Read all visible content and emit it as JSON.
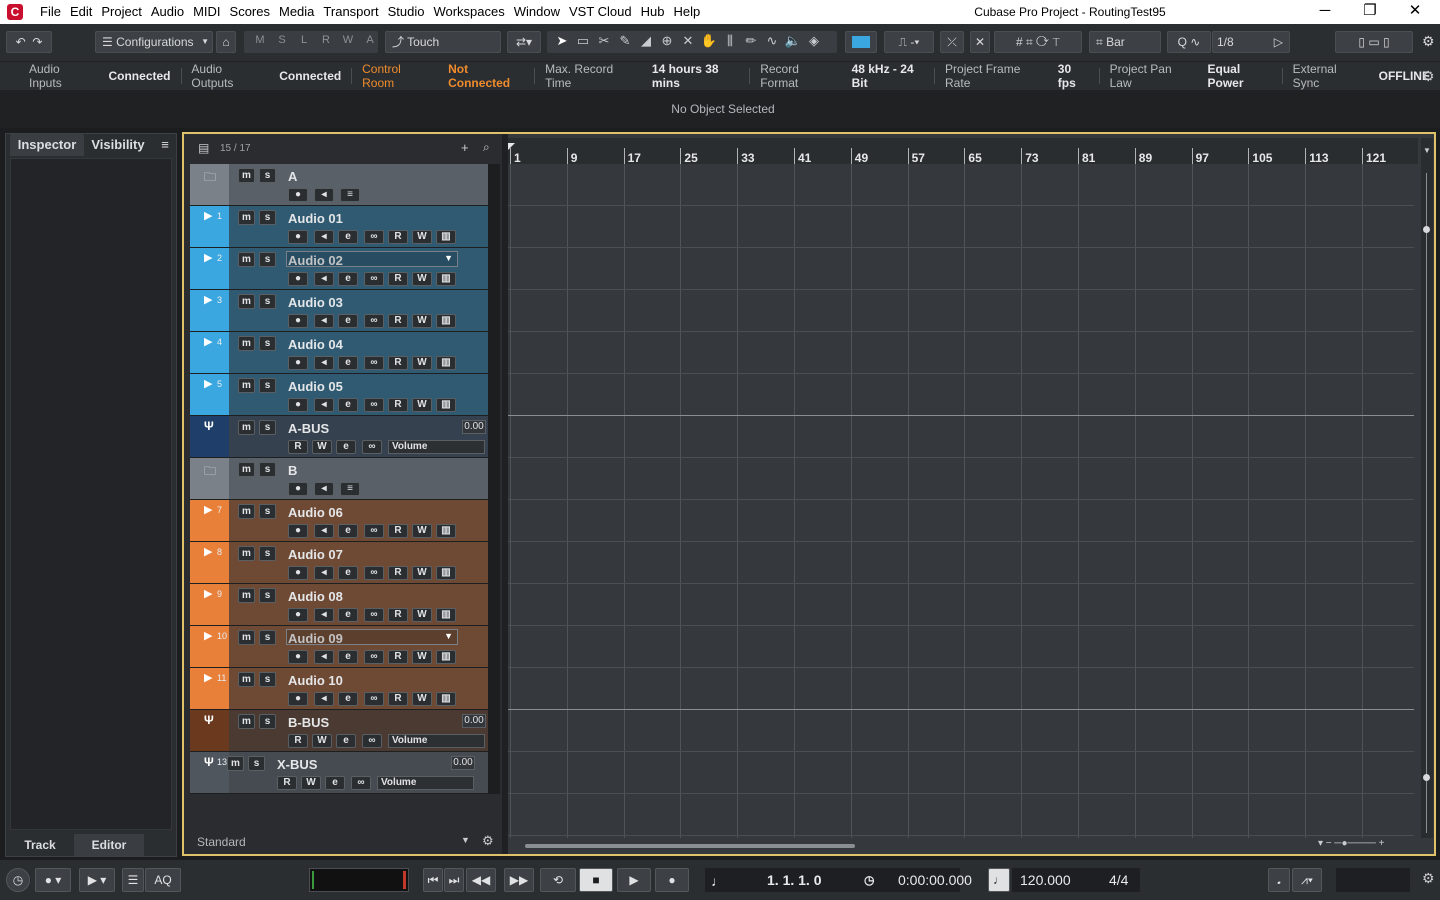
{
  "menubar": {
    "items": [
      "File",
      "Edit",
      "Project",
      "Audio",
      "MIDI",
      "Scores",
      "Media",
      "Transport",
      "Studio",
      "Workspaces",
      "Window",
      "VST Cloud",
      "Hub",
      "Help"
    ],
    "window_title": "Cubase Pro Project - RoutingTest95",
    "minimize": "─",
    "maximize": "❐",
    "close": "✕"
  },
  "toolbar": {
    "configurations": "Configurations",
    "states": [
      "M",
      "S",
      "L",
      "R",
      "W",
      "A"
    ],
    "automation_mode": "Touch",
    "grid_type": "Bar",
    "quantize": "1/8"
  },
  "status": {
    "audio_inputs_label": "Audio Inputs",
    "audio_inputs_value": "Connected",
    "audio_outputs_label": "Audio Outputs",
    "audio_outputs_value": "Connected",
    "control_room_label": "Control Room",
    "control_room_value": "Not Connected",
    "max_record_label": "Max. Record Time",
    "max_record_value": "14 hours 38 mins",
    "record_format_label": "Record Format",
    "record_format_value": "48 kHz - 24 Bit",
    "frame_rate_label": "Project Frame Rate",
    "frame_rate_value": "30 fps",
    "pan_law_label": "Project Pan Law",
    "pan_law_value": "Equal Power",
    "ext_sync_label": "External Sync",
    "ext_sync_value": "OFFLINE",
    "info_line": "No Object Selected"
  },
  "inspector": {
    "tab_inspector": "Inspector",
    "tab_visibility": "Visibility",
    "tab_track": "Track",
    "tab_editor": "Editor"
  },
  "tracklist": {
    "count": "15 / 17",
    "footer": "Standard",
    "tracks": [
      {
        "type": "folder",
        "name": "A",
        "num": ""
      },
      {
        "type": "audio",
        "name": "Audio 01",
        "num": "1"
      },
      {
        "type": "audio",
        "name": "Audio 02",
        "num": "2"
      },
      {
        "type": "audio",
        "name": "Audio 03",
        "num": "3"
      },
      {
        "type": "audio",
        "name": "Audio 04",
        "num": "4"
      },
      {
        "type": "audio",
        "name": "Audio 05",
        "num": "5"
      },
      {
        "type": "group",
        "name": "A-BUS",
        "num": "",
        "vol": "0.00",
        "vol_label": "Volume"
      },
      {
        "type": "folder",
        "name": "B",
        "num": ""
      },
      {
        "type": "audio",
        "name": "Audio 06",
        "num": "7"
      },
      {
        "type": "audio",
        "name": "Audio 07",
        "num": "8"
      },
      {
        "type": "audio",
        "name": "Audio 08",
        "num": "9"
      },
      {
        "type": "audio",
        "name": "Audio 09",
        "num": "10"
      },
      {
        "type": "audio",
        "name": "Audio 10",
        "num": "11"
      },
      {
        "type": "group",
        "name": "B-BUS",
        "num": "",
        "vol": "0.00",
        "vol_label": "Volume"
      },
      {
        "type": "group",
        "name": "X-BUS",
        "num": "13",
        "vol": "0.00",
        "vol_label": "Volume"
      }
    ],
    "colors": {
      "blue": "#3ba7e0",
      "blue_bg": "#2f5a72",
      "orange": "#e8803a",
      "orange_bg": "#6e4a35",
      "folder_bg": "#5a6068",
      "bus_blue": "#1f3f6a",
      "bus_orange": "#6b3a1e",
      "bus_x": "#4a5058"
    }
  },
  "ruler": {
    "bars": [
      "1",
      "9",
      "17",
      "25",
      "33",
      "41",
      "49",
      "57",
      "65",
      "73",
      "81",
      "89",
      "97",
      "105",
      "113",
      "121"
    ]
  },
  "transport": {
    "position": "1.  1.  1.    0",
    "time": "0:00:00.000",
    "tempo": "120.000",
    "signature": "4/4",
    "aq": "AQ"
  }
}
